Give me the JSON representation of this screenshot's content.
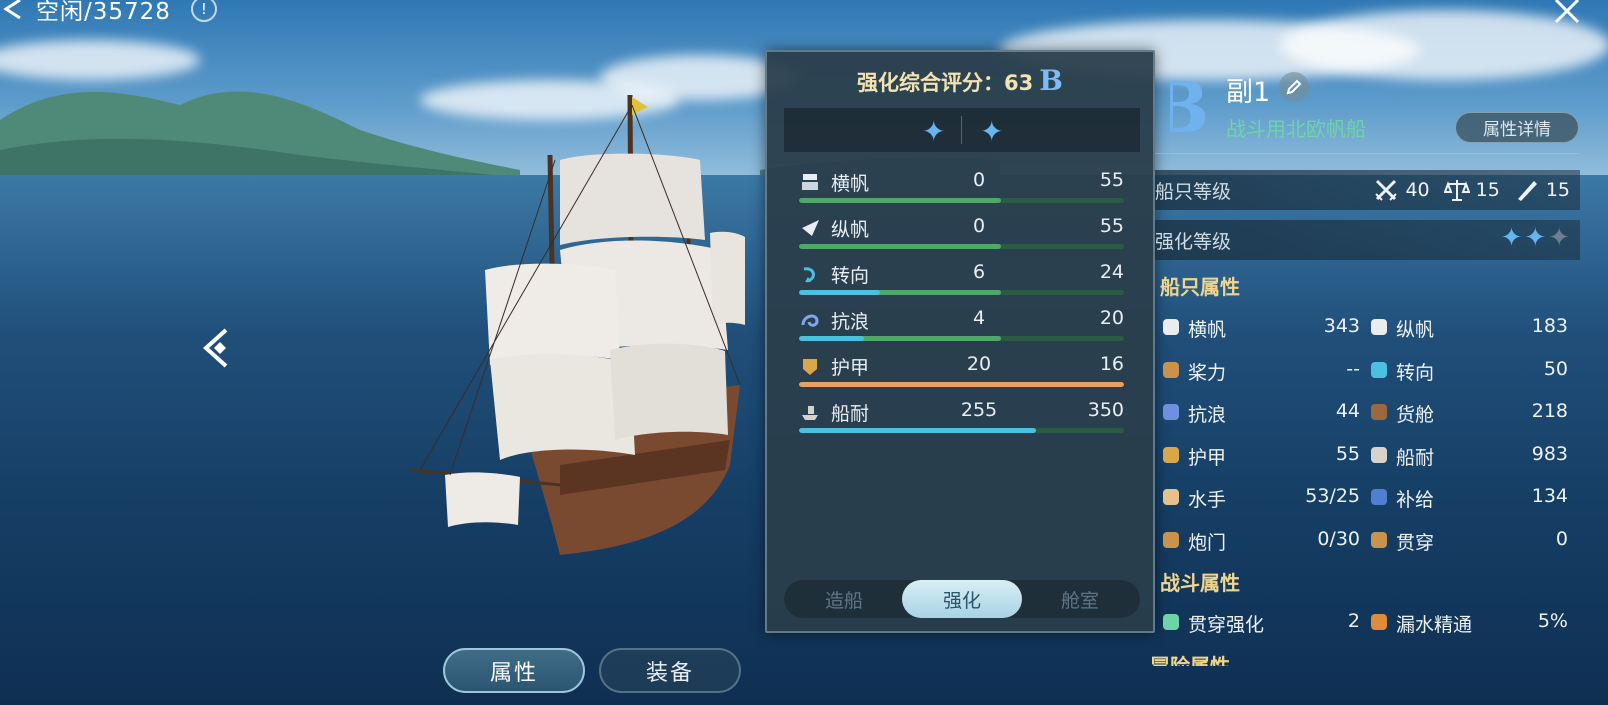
{
  "top_bar": {
    "status": "空闲/35728",
    "info_label": "!"
  },
  "bottom_tabs": [
    "属性",
    "装备"
  ],
  "panel": {
    "title": "强化综合评分：",
    "score": "63",
    "grade": "B",
    "stats": [
      {
        "name": "横帆",
        "current": "0",
        "max": "55",
        "fill": 0.62,
        "color": "#4fa76a"
      },
      {
        "name": "纵帆",
        "current": "0",
        "max": "55",
        "fill": 0.62,
        "color": "#4fa76a"
      },
      {
        "name": "转向",
        "current": "6",
        "max": "24",
        "fill": 0.62,
        "color": "#4fa76a",
        "prefill": 0.25,
        "precolor": "#4cc0df"
      },
      {
        "name": "抗浪",
        "current": "4",
        "max": "20",
        "fill": 0.62,
        "color": "#4fa76a",
        "prefill": 0.2,
        "precolor": "#4cc0df"
      },
      {
        "name": "护甲",
        "current": "20",
        "max": "16",
        "fill": 1.0,
        "color": "#e9a060"
      },
      {
        "name": "船耐",
        "current": "255",
        "max": "350",
        "fill": 0.73,
        "color": "#4cc0df"
      }
    ],
    "tabs": [
      "造船",
      "强化",
      "舱室"
    ],
    "active_tab": 1
  },
  "ship": {
    "grade": "B",
    "name": "副1",
    "type": "战斗用北欧帆船",
    "detail_button": "属性详情",
    "level_label": "船只等级",
    "levels": {
      "combat": "40",
      "trade": "15",
      "adventure": "15"
    },
    "strength_label": "强化等级",
    "strength_stars": "✦✦",
    "strength_stars_dim": "✦",
    "attr_section": "船只属性",
    "attrs": [
      {
        "k": "横帆",
        "v": "343"
      },
      {
        "k": "纵帆",
        "v": "183"
      },
      {
        "k": "桨力",
        "v": "--"
      },
      {
        "k": "转向",
        "v": "50"
      },
      {
        "k": "抗浪",
        "v": "44"
      },
      {
        "k": "货舱",
        "v": "218"
      },
      {
        "k": "护甲",
        "v": "55"
      },
      {
        "k": "船耐",
        "v": "983"
      },
      {
        "k": "水手",
        "v": "53/25"
      },
      {
        "k": "补给",
        "v": "134"
      },
      {
        "k": "炮门",
        "v": "0/30"
      },
      {
        "k": "贯穿",
        "v": "0"
      }
    ],
    "battle_section": "战斗属性",
    "battle_attrs": [
      {
        "k": "贯穿强化",
        "v": "2"
      },
      {
        "k": "漏水精通",
        "v": "5%"
      }
    ],
    "adventure_section": "冒险属性"
  }
}
